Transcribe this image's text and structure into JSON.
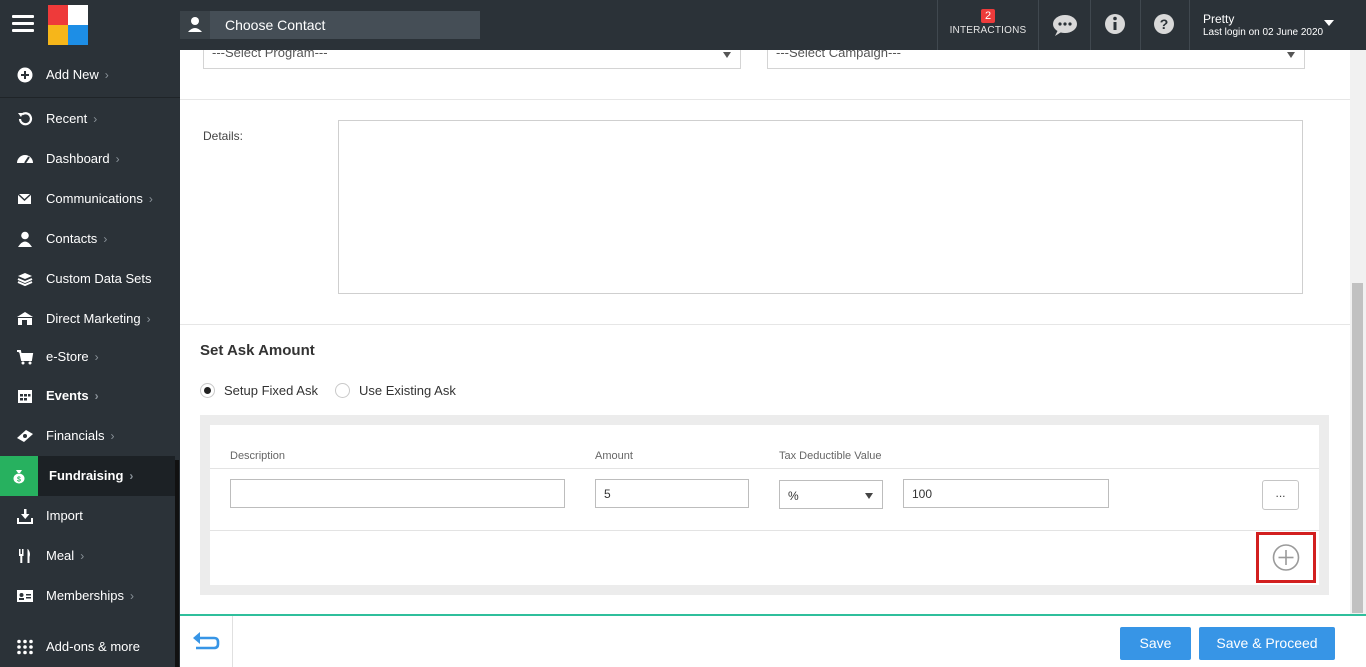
{
  "topbar": {
    "contact_label": "Choose Contact",
    "interactions_count": "2",
    "interactions_label": "INTERACTIONS",
    "user_name": "Pretty",
    "last_login": "Last login on 02 June 2020"
  },
  "sidebar": {
    "items": [
      {
        "label": "Add New",
        "icon": "plus-circle-icon"
      },
      {
        "label": "Recent",
        "icon": "history-icon"
      },
      {
        "label": "Dashboard",
        "icon": "dashboard-icon"
      },
      {
        "label": "Communications",
        "icon": "envelope-icon"
      },
      {
        "label": "Contacts",
        "icon": "user-icon"
      },
      {
        "label": "Custom Data Sets",
        "icon": "database-icon"
      },
      {
        "label": "Direct Marketing",
        "icon": "bank-icon"
      },
      {
        "label": "e-Store",
        "icon": "cart-icon"
      },
      {
        "label": "Events",
        "icon": "calendar-icon"
      },
      {
        "label": "Financials",
        "icon": "money-icon"
      },
      {
        "label": "Fundraising",
        "icon": "money-bag-icon"
      },
      {
        "label": "Import",
        "icon": "download-icon"
      },
      {
        "label": "Meal",
        "icon": "utensils-icon"
      },
      {
        "label": "Memberships",
        "icon": "id-card-icon"
      },
      {
        "label": "Add-ons & more",
        "icon": "grid-icon"
      }
    ]
  },
  "form": {
    "program_placeholder": "---Select Program---",
    "campaign_placeholder": "---Select Campaign---",
    "details_label": "Details:",
    "details_value": ""
  },
  "ask": {
    "title": "Set Ask Amount",
    "options": [
      {
        "label": "Setup Fixed Ask",
        "selected": true
      },
      {
        "label": "Use Existing Ask",
        "selected": false
      }
    ],
    "columns": [
      "Description",
      "Amount",
      "Tax Deductible Value"
    ],
    "rows": [
      {
        "description": "",
        "amount": "5",
        "tax_type": "%",
        "tax_value": "100",
        "more": "..."
      }
    ]
  },
  "footer": {
    "save_label": "Save",
    "save_proceed_label": "Save & Proceed"
  },
  "colors": {
    "sidebar_bg": "#2b3238",
    "accent_green": "#27b15f",
    "primary_button": "#3795e6",
    "highlight_red": "#d21f1f",
    "footer_border": "#2fbf9c"
  }
}
